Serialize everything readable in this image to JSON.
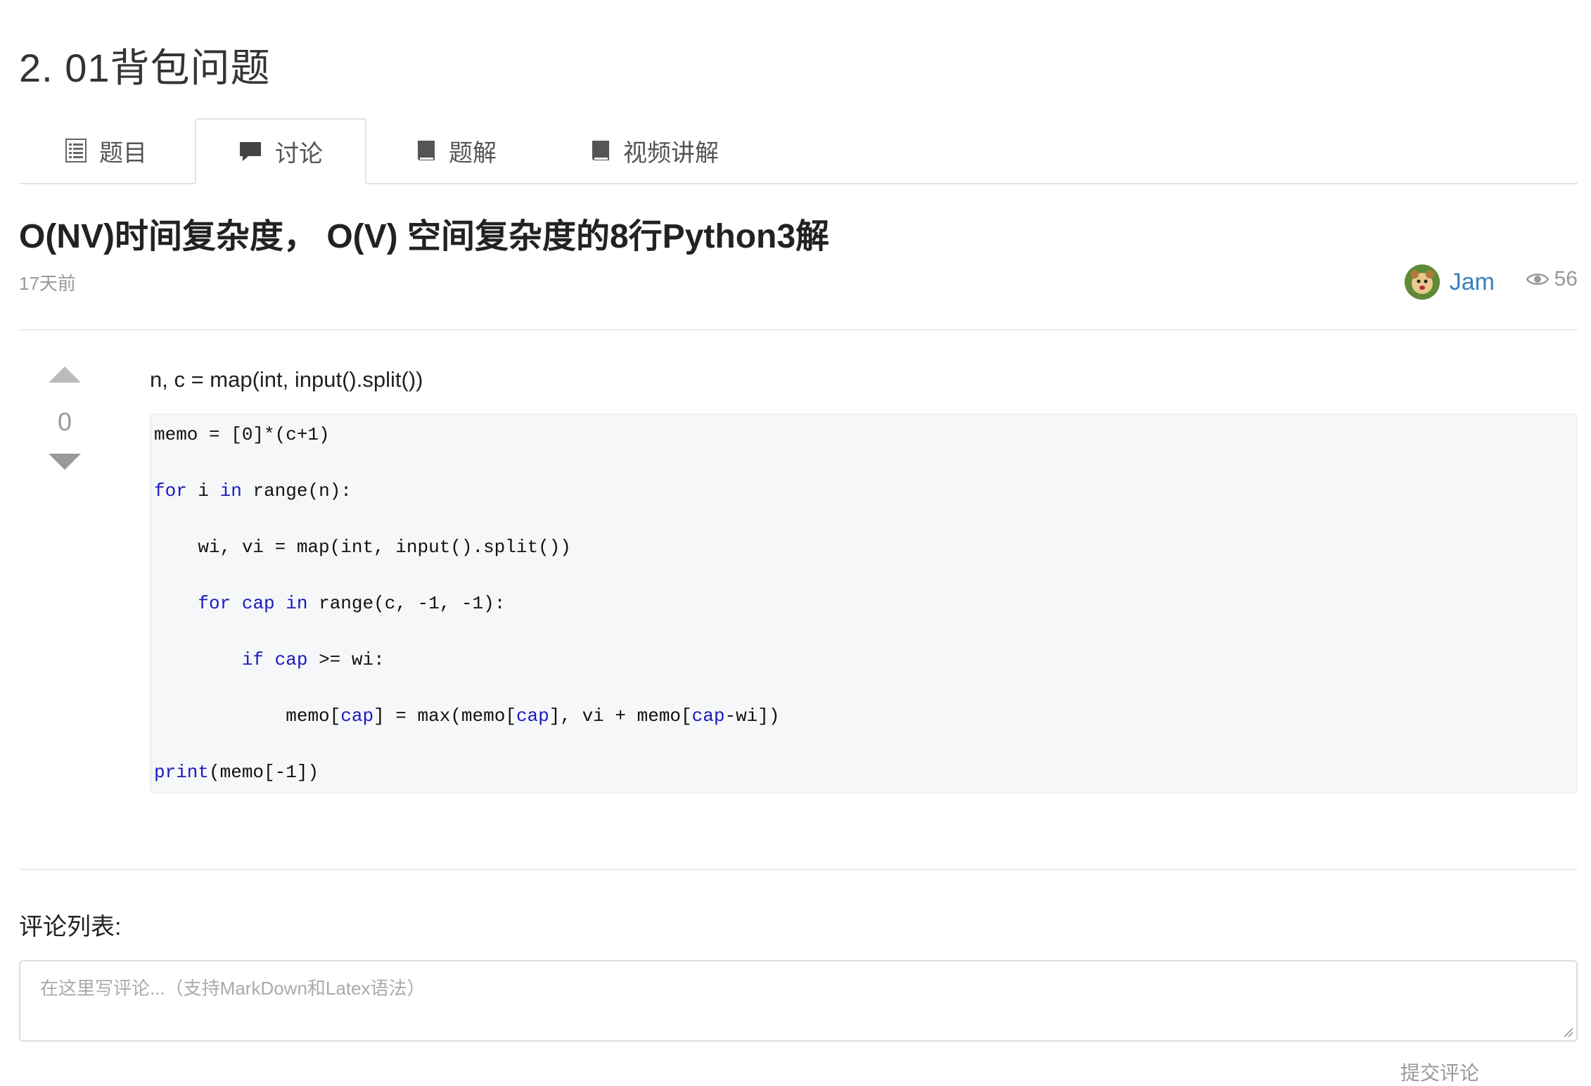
{
  "problem": {
    "title": "2. 01背包问题"
  },
  "tabs": [
    {
      "label": "题目",
      "icon": "list-icon",
      "active": false
    },
    {
      "label": "讨论",
      "icon": "chat-icon",
      "active": true
    },
    {
      "label": "题解",
      "icon": "book-icon",
      "active": false
    },
    {
      "label": "视频讲解",
      "icon": "book-icon",
      "active": false
    }
  ],
  "post": {
    "title": "O(NV)时间复杂度， O(V) 空间复杂度的8行Python3解",
    "time": "17天前",
    "author": "Jam",
    "views": "56",
    "votes": "0",
    "first_line": "n, c = map(int, input().split())",
    "code_lines": [
      "memo = [0]*(c+1)",
      "for i in range(n):",
      "    wi, vi = map(int, input().split())",
      "    for cap in range(c, -1, -1):",
      "        if cap >= wi:",
      "            memo[cap] = max(memo[cap], vi + memo[cap-wi])",
      "print(memo[-1])"
    ]
  },
  "comments": {
    "label": "评论列表:",
    "placeholder": "在这里写评论...（支持MarkDown和Latex语法）",
    "submit_label": "提交评论"
  },
  "colors": {
    "author_link": "#3a7fc0",
    "keyword": "#1a1ac0",
    "code_bg": "#f6f7f8"
  }
}
